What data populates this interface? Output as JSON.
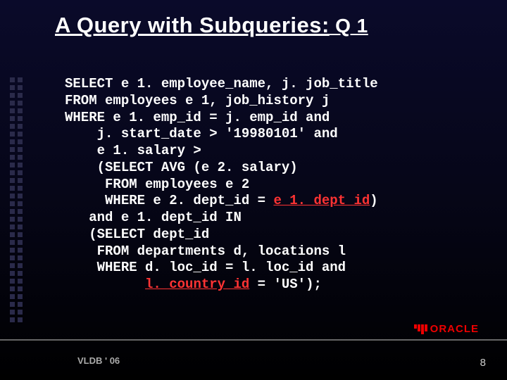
{
  "title_pre": "A Query with Subqueries:",
  "title_q": " Q 1",
  "code": {
    "l1": "SELECT e 1. employee_name, j. job_title",
    "l2": "FROM employees e 1, job_history j",
    "l3": "WHERE e 1. emp_id = j. emp_id and",
    "l4": "    j. start_date > '19980101' and",
    "l5": "    e 1. salary >",
    "l6": "    (SELECT AVG (e 2. salary)",
    "l7": "     FROM employees e 2",
    "l8a": "     WHERE e 2. dept_id = ",
    "l8b": "e 1. dept_id",
    "l8c": ")",
    "l9": "   and e 1. dept_id IN",
    "l10": "   (SELECT dept_id",
    "l11": "    FROM departments d, locations l",
    "l12": "    WHERE d. loc_id = l. loc_id and",
    "l13a": "          ",
    "l13b": "l. country_id",
    "l13c": " = 'US');"
  },
  "footer": "VLDB  ' 06",
  "page": "8",
  "logo": "ORACLE"
}
